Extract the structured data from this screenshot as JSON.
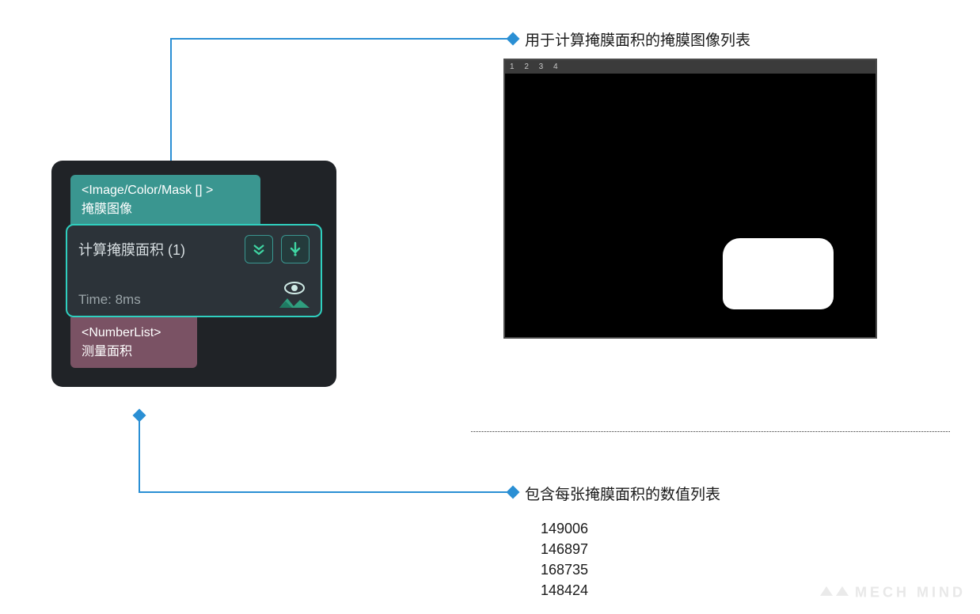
{
  "callouts": {
    "top": "用于计算掩膜面积的掩膜图像列表",
    "bottom": "包含每张掩膜面积的数值列表"
  },
  "node": {
    "input": {
      "type_label": "<Image/Color/Mask [] >",
      "name": "掩膜图像"
    },
    "main": {
      "title": "计算掩膜面积 (1)",
      "time_label": "Time: 8ms"
    },
    "output": {
      "type_label": "<NumberList>",
      "name": "测量面积"
    }
  },
  "preview": {
    "tabs": "1 2 3 4"
  },
  "results": {
    "values": [
      "149006",
      "146897",
      "168735",
      "148424"
    ]
  },
  "watermark": "MECH MIND"
}
